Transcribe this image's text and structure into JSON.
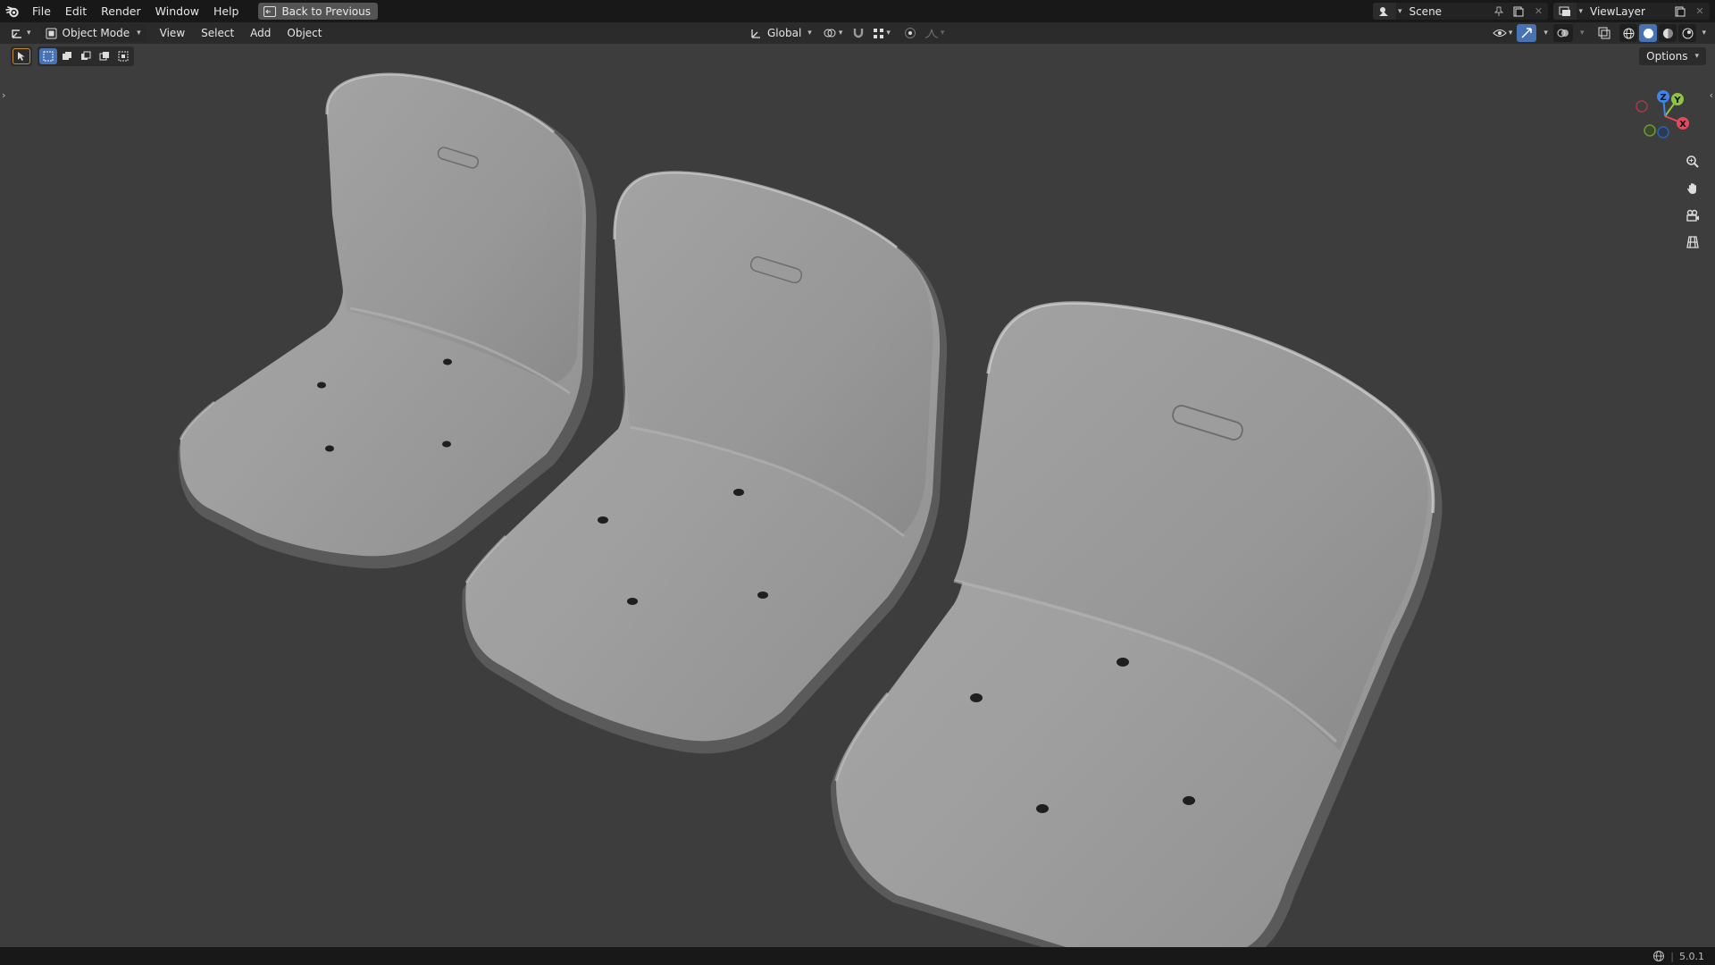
{
  "menu": {
    "items": [
      "File",
      "Edit",
      "Render",
      "Window",
      "Help"
    ],
    "back_button": "Back to Previous"
  },
  "topbar_right": {
    "scene": "Scene",
    "view_layer": "ViewLayer"
  },
  "viewport_header": {
    "mode": "Object Mode",
    "menus": [
      "View",
      "Select",
      "Add",
      "Object"
    ],
    "orientation": "Global",
    "options": "Options"
  },
  "statusbar": {
    "version": "5.0.1"
  },
  "gizmo": {
    "axes": [
      "Z",
      "Y",
      "X"
    ],
    "colors": {
      "x": "#e04b5f",
      "y": "#8cc63f",
      "z": "#3d86e6"
    }
  },
  "scene_content": {
    "objects": [
      "seat-shell",
      "seat-shell",
      "seat-shell"
    ]
  }
}
